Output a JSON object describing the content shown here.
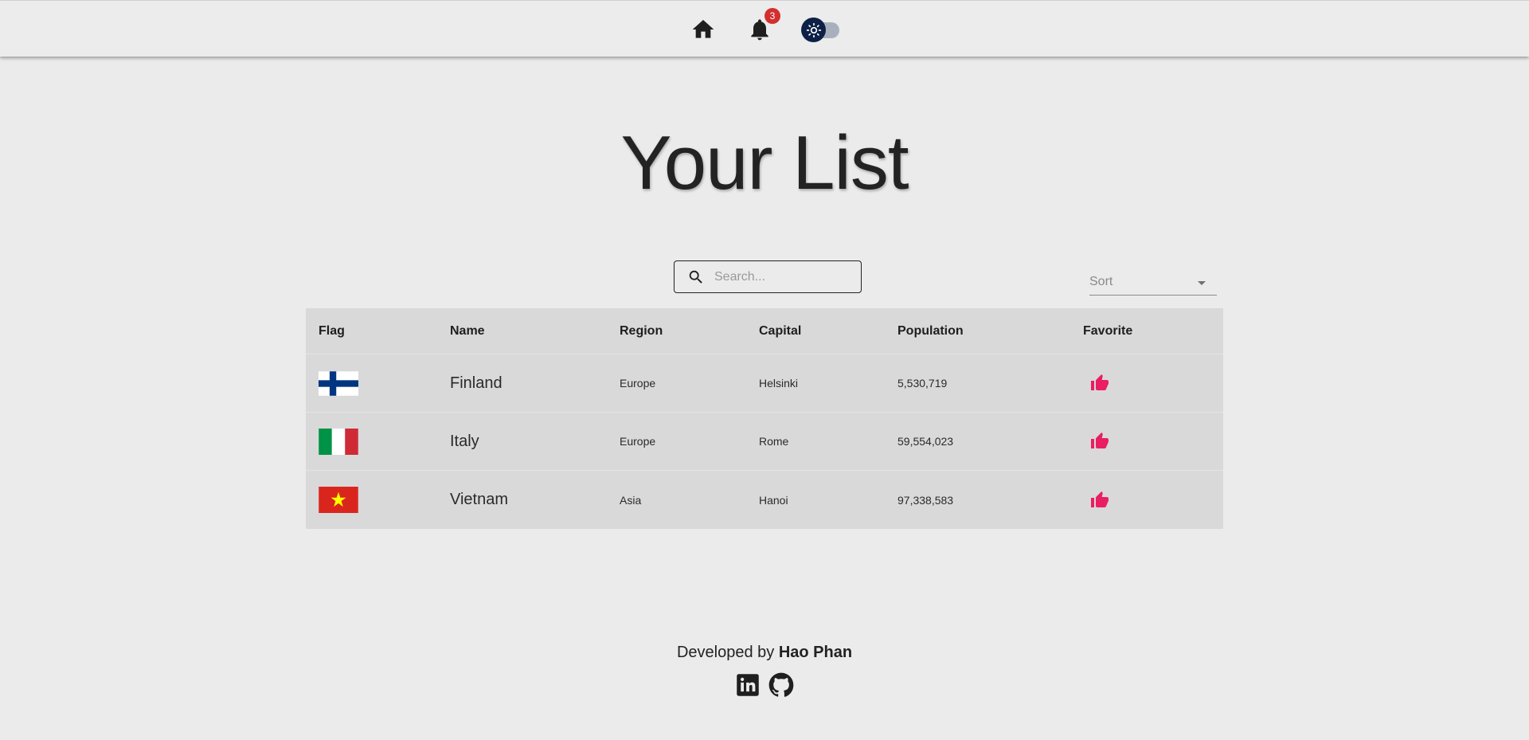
{
  "appbar": {
    "notification_count": "3"
  },
  "icons": {
    "home": "home-icon",
    "notifications": "bell-icon",
    "theme": "sun-icon",
    "search": "search-icon",
    "favorite": "thumb-up-icon",
    "linkedin": "linkedin-icon",
    "github": "github-icon"
  },
  "colors": {
    "background": "#ebebeb",
    "badge": "#d32f2f",
    "favorite": "#e91e63",
    "toggle_thumb": "#0d2147",
    "table": "#d9d9d9"
  },
  "page": {
    "title": "Your List"
  },
  "search": {
    "placeholder": "Search..."
  },
  "sort": {
    "label": "Sort"
  },
  "table": {
    "headers": [
      "Flag",
      "Name",
      "Region",
      "Capital",
      "Population",
      "Favorite"
    ],
    "rows": [
      {
        "flag": "finland",
        "name": "Finland",
        "region": "Europe",
        "capital": "Helsinki",
        "population": "5,530,719"
      },
      {
        "flag": "italy",
        "name": "Italy",
        "region": "Europe",
        "capital": "Rome",
        "population": "59,554,023"
      },
      {
        "flag": "vietnam",
        "name": "Vietnam",
        "region": "Asia",
        "capital": "Hanoi",
        "population": "97,338,583"
      }
    ]
  },
  "footer": {
    "developed_by": "Developed by",
    "author": "Hao Phan"
  }
}
